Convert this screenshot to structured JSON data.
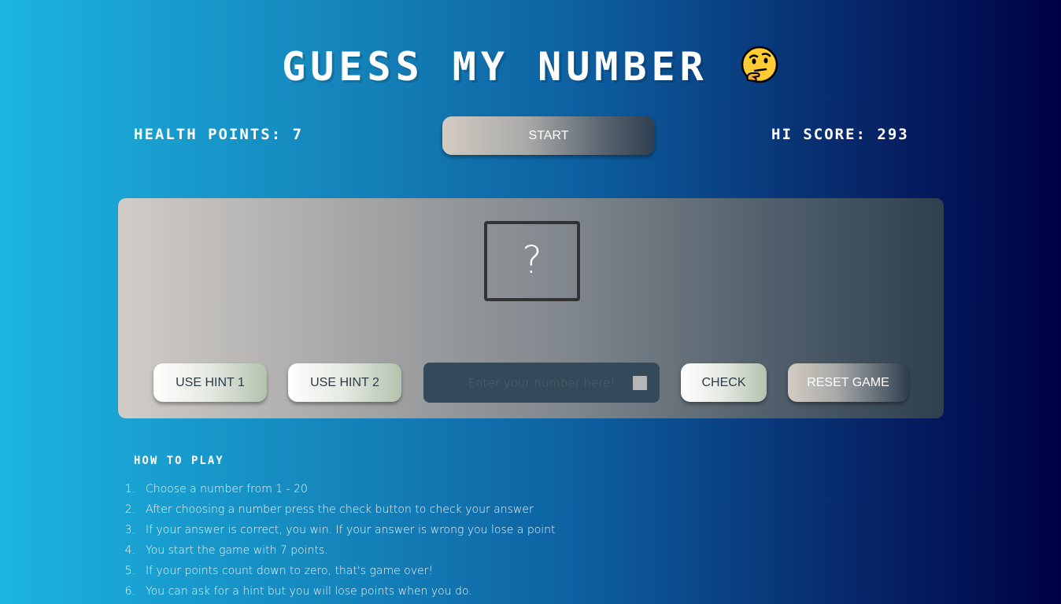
{
  "title": "GUESS MY NUMBER",
  "title_icon": "thinking-face-emoji",
  "stats": {
    "health_label": "HEALTH POINTS: 7",
    "hiscore_label": "HI SCORE: 293"
  },
  "start_label": "START",
  "secret": "?",
  "controls": {
    "hint1_label": "USE HINT 1",
    "hint2_label": "USE HINT 2",
    "input_placeholder": "Enter your number here!",
    "check_label": "CHECK",
    "reset_label": "RESET GAME"
  },
  "how_to_play": {
    "title": "HOW TO PLAY",
    "steps": [
      {
        "n": "1.",
        "text": "Choose a number from 1 - 20"
      },
      {
        "n": "2.",
        "text": "After choosing a number press the check button to check your answer"
      },
      {
        "n": "3.",
        "text": "If your answer is correct, you win. If your answer is wrong you lose a point"
      },
      {
        "n": "4.",
        "text": "You start the game with 7 points."
      },
      {
        "n": "5.",
        "text": "If your points count down to zero, that's game over!"
      },
      {
        "n": "6.",
        "text": "You can ask for a hint but you will lose points when you do."
      }
    ]
  },
  "colors": {
    "bg_left": "#1cb5e0",
    "bg_right": "#000046",
    "input_bg": "#34495a"
  }
}
